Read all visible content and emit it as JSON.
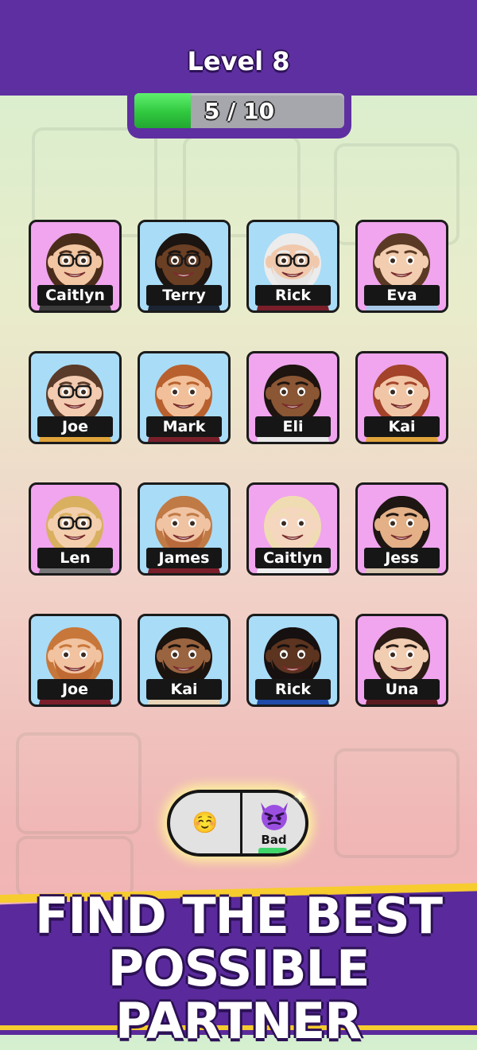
{
  "header": {
    "level_label": "Level 8",
    "progress_text": "5 / 10",
    "progress_fraction": 0.27
  },
  "colors": {
    "header_purple": "#5e2fa0",
    "card_pink": "#f0a5ee",
    "card_blue": "#a9dcf7",
    "progress_green": "#30c83f"
  },
  "cards": [
    {
      "name": "Caitlyn",
      "bg": "pink",
      "skin": "#f2c6a3",
      "hair": "#4a2c1a",
      "glasses": true,
      "beard": false,
      "shirt": "#3b3b3b"
    },
    {
      "name": "Terry",
      "bg": "blue",
      "skin": "#6b3f24",
      "hair": "#1b1410",
      "glasses": true,
      "beard": false,
      "shirt": "#1c2433"
    },
    {
      "name": "Rick",
      "bg": "blue",
      "skin": "#f0c9ad",
      "hair": "#ececec",
      "glasses": true,
      "beard": true,
      "beardColor": "#e6e6e6",
      "shirt": "#7a1f2a"
    },
    {
      "name": "Eva",
      "bg": "pink",
      "skin": "#f3cdb0",
      "hair": "#5a3a24",
      "glasses": false,
      "beard": false,
      "shirt": "#a8c7e6"
    },
    {
      "name": "Joe",
      "bg": "blue",
      "skin": "#f3cbb0",
      "hair": "#5a3a28",
      "glasses": true,
      "beard": false,
      "shirt": "#e0a43a"
    },
    {
      "name": "Mark",
      "bg": "blue",
      "skin": "#f1c09a",
      "hair": "#b8612e",
      "glasses": false,
      "beard": false,
      "shirt": "#7a1f2a"
    },
    {
      "name": "Eli",
      "bg": "pink",
      "skin": "#8a5634",
      "hair": "#1e1410",
      "glasses": false,
      "beard": false,
      "shirt": "#e9e9e9"
    },
    {
      "name": "Kai",
      "bg": "pink",
      "skin": "#f1c6a6",
      "hair": "#a3432a",
      "glasses": false,
      "beard": false,
      "shirt": "#e0a43a"
    },
    {
      "name": "Len",
      "bg": "pink",
      "skin": "#f3cfae",
      "hair": "#d8b060",
      "glasses": true,
      "beard": false,
      "shirt": "#777777"
    },
    {
      "name": "James",
      "bg": "blue",
      "skin": "#f0c3a3",
      "hair": "#c07a45",
      "glasses": false,
      "beard": true,
      "beardColor": "#b86a3c",
      "shirt": "#7a1f2a"
    },
    {
      "name": "Caitlyn",
      "bg": "pink",
      "skin": "#f5d6bf",
      "hair": "#f0dcb2",
      "glasses": false,
      "beard": false,
      "shirt": "#eeeeee"
    },
    {
      "name": "Jess",
      "bg": "pink",
      "skin": "#e3b087",
      "hair": "#1e1612",
      "glasses": false,
      "beard": false,
      "shirt": "#d8c7b0"
    },
    {
      "name": "Joe",
      "bg": "blue",
      "skin": "#f1c3a0",
      "hair": "#c8773a",
      "glasses": false,
      "beard": true,
      "beardColor": "#c06a33",
      "shirt": "#7a1f2a"
    },
    {
      "name": "Kai",
      "bg": "blue",
      "skin": "#9a6440",
      "hair": "#1b130e",
      "glasses": false,
      "beard": true,
      "beardColor": "#1b130e",
      "shirt": "#e8d4b8"
    },
    {
      "name": "Rick",
      "bg": "blue",
      "skin": "#5c341f",
      "hair": "#161010",
      "glasses": false,
      "beard": true,
      "beardColor": "#161010",
      "shirt": "#1f4aa8"
    },
    {
      "name": "Una",
      "bg": "pink",
      "skin": "#f1cdb2",
      "hair": "#2a1c14",
      "glasses": false,
      "beard": false,
      "shirt": "#5a1a1f"
    }
  ],
  "reaction_pill": {
    "left_emoji": "☺️",
    "right_emoji_icon": "devil-emoji-icon",
    "right_label": "Bad"
  },
  "banner": {
    "line1": "FIND THE BEST",
    "line2": "POSSIBLE PARTNER"
  }
}
